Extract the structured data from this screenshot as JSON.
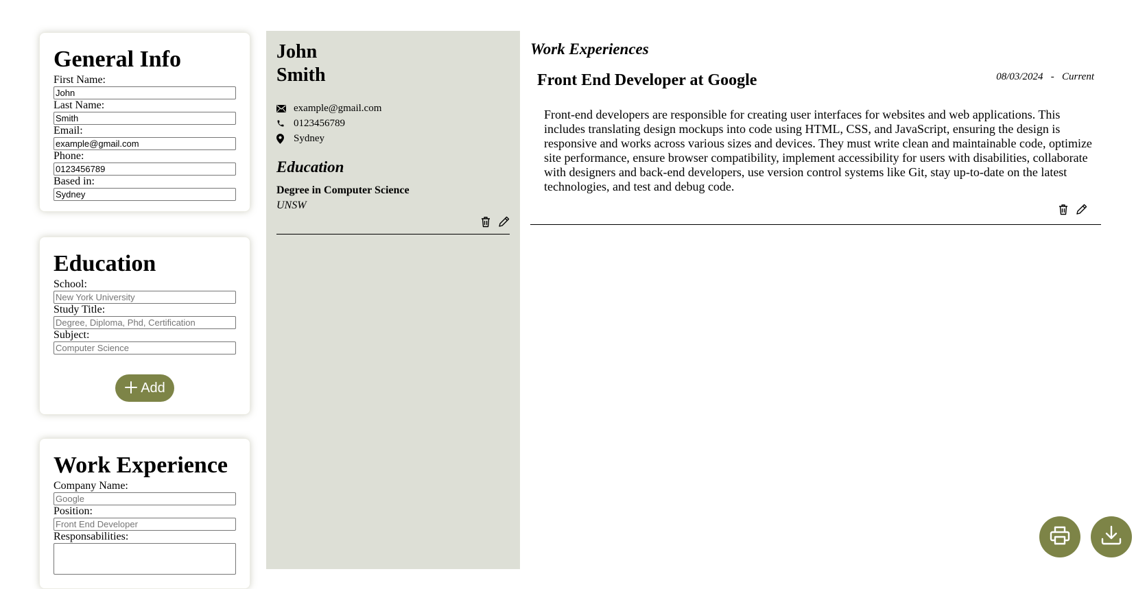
{
  "general_info": {
    "title": "General Info",
    "first_name_label": "First Name:",
    "first_name_value": "John",
    "last_name_label": "Last Name:",
    "last_name_value": "Smith",
    "email_label": "Email:",
    "email_value": "example@gmail.com",
    "phone_label": "Phone:",
    "phone_value": "0123456789",
    "based_label": "Based in:",
    "based_value": "Sydney"
  },
  "education_form": {
    "title": "Education",
    "school_label": "School:",
    "school_placeholder": "New York University",
    "study_label": "Study Title:",
    "study_placeholder": "Degree, Diploma, Phd, Certification",
    "subject_label": "Subject:",
    "subject_placeholder": "Computer Science",
    "add_label": "Add"
  },
  "work_form": {
    "title": "Work Experience",
    "company_label": "Company Name:",
    "company_placeholder": "Google",
    "position_label": "Position:",
    "position_placeholder": "Front End Developer",
    "resp_label": "Responsabilities:"
  },
  "cv": {
    "first_name": "John",
    "last_name": "Smith",
    "email": "example@gmail.com",
    "phone": "0123456789",
    "location": "Sydney",
    "education_heading": "Education",
    "education": [
      {
        "degree": "Degree in Computer Science",
        "school": "UNSW"
      }
    ],
    "work_heading": "Work Experiences",
    "work": [
      {
        "title": "Front End Developer at Google",
        "start": "08/03/2024",
        "separator": "-",
        "end": "Current",
        "description": "Front-end developers are responsible for creating user interfaces for websites and web applications. This includes translating design mockups into code using HTML, CSS, and JavaScript, ensuring the design is responsive and works across various sizes and devices. They must write clean and maintainable code, optimize site performance, ensure browser compatibility, implement accessibility for users with disabilities, collaborate with designers and back-end developers, use version control systems like Git, stay up-to-date on the latest technologies, and test and debug code."
      }
    ]
  },
  "icons": {
    "email": "envelope-icon",
    "phone": "phone-icon",
    "location": "map-pin-icon",
    "delete": "trash-icon",
    "edit": "pencil-icon",
    "print": "printer-icon",
    "download": "download-icon"
  },
  "colors": {
    "accent": "#7d8447",
    "sidebar": "#dddfd6"
  }
}
